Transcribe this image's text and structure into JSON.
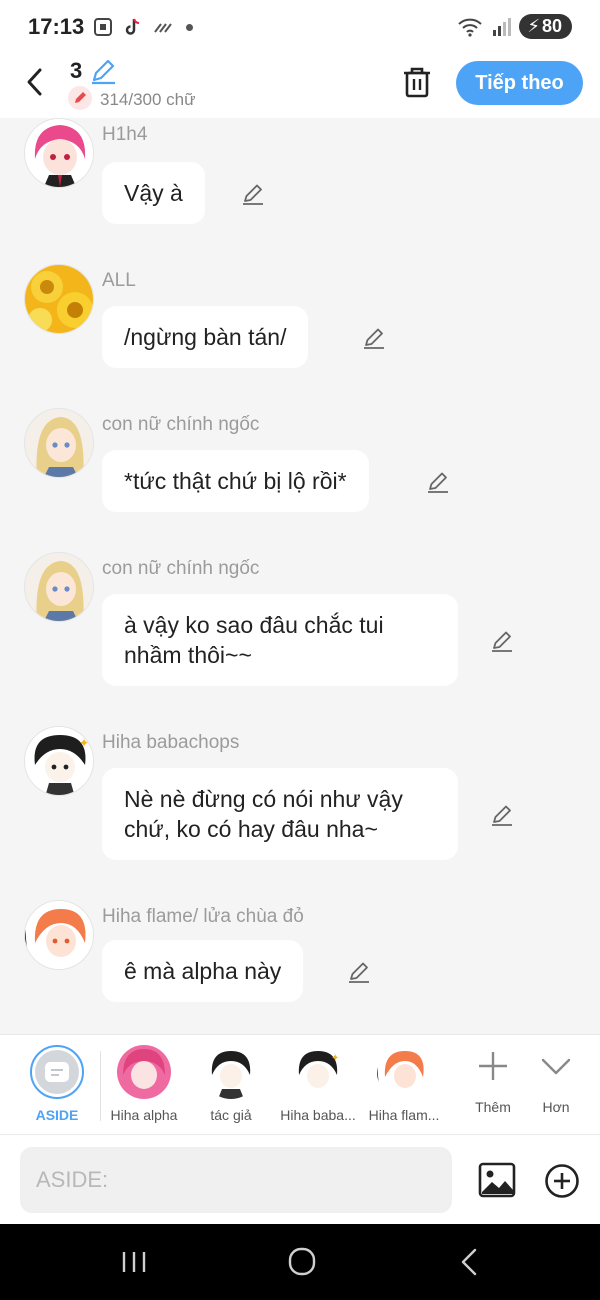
{
  "status_bar": {
    "time": "17:13",
    "battery": "80"
  },
  "header": {
    "title": "3",
    "word_count": "314/300 chữ",
    "next_label": "Tiếp theo"
  },
  "messages": [
    {
      "sender": "H1h4",
      "text": "Vậy à"
    },
    {
      "sender": "ALL",
      "text": "/ngừng bàn tán/"
    },
    {
      "sender": "con nữ chính ngốc",
      "text": "*tức thật chứ bị lộ rồi*"
    },
    {
      "sender": "con nữ chính ngốc",
      "text": "à vậy ko sao đâu chắc tui\nnhầm thôi~~"
    },
    {
      "sender": "Hiha babachops",
      "text": "Nè nè đừng có nói như vậy\nchứ, ko có hay đâu nha~"
    },
    {
      "sender": "Hiha flame/ lửa chùa đỏ",
      "text": "ê mà alpha này"
    }
  ],
  "characters": [
    {
      "label": "ASIDE"
    },
    {
      "label": "Hiha alpha"
    },
    {
      "label": "tác giả"
    },
    {
      "label": "Hiha baba..."
    },
    {
      "label": "Hiha flam..."
    },
    {
      "label": "Thêm"
    },
    {
      "label": "Hơn"
    }
  ],
  "input": {
    "placeholder": "ASIDE:",
    "value": ""
  },
  "colors": {
    "accent": "#4da3f5",
    "background": "#f5f5f5",
    "bubble": "#ffffff"
  }
}
